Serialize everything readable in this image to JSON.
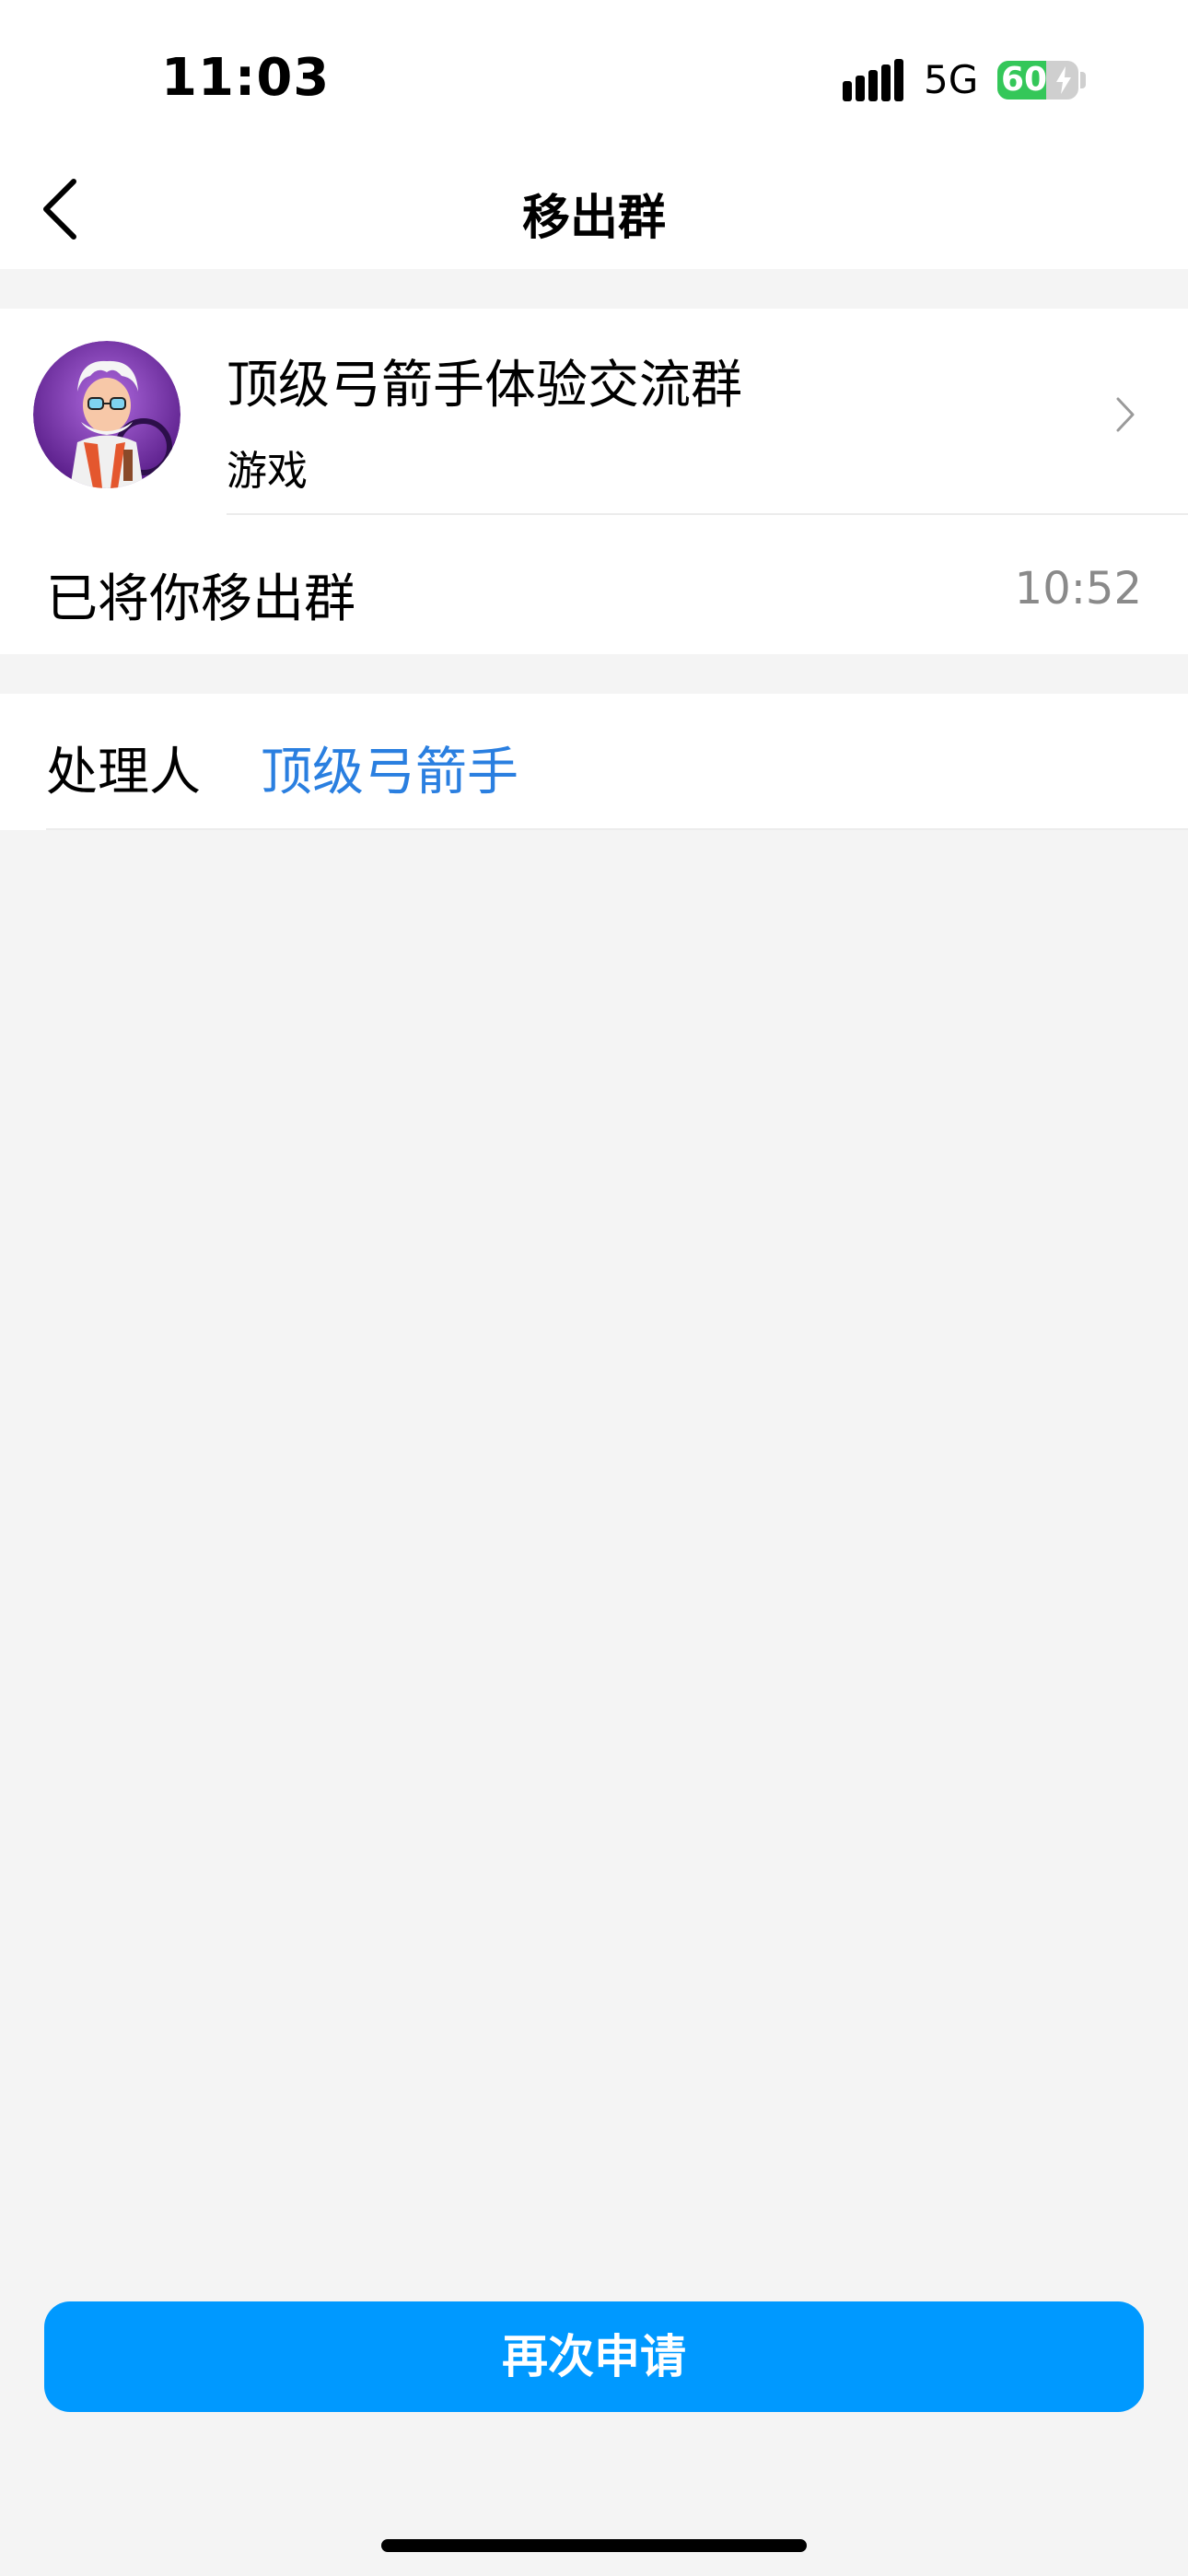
{
  "status_bar": {
    "time": "11:03",
    "network": "5G",
    "battery_percent": "60",
    "battery_level": 0.6,
    "signal_icon": "cellular-signal-icon",
    "battery_color": "#34c759"
  },
  "nav": {
    "back_icon": "chevron-left-icon",
    "title": "移出群"
  },
  "group": {
    "name": "顶级弓箭手体验交流群",
    "category": "游戏",
    "avatar_icon": "cartoon-scientist-avatar",
    "chevron_icon": "chevron-right-icon"
  },
  "notice": {
    "message": "已将你移出群",
    "time": "10:52"
  },
  "handler": {
    "label": "处理人",
    "name": "顶级弓箭手",
    "name_color": "#2a7fe0"
  },
  "actions": {
    "reapply_label": "再次申请",
    "reapply_color": "#0099ff"
  }
}
